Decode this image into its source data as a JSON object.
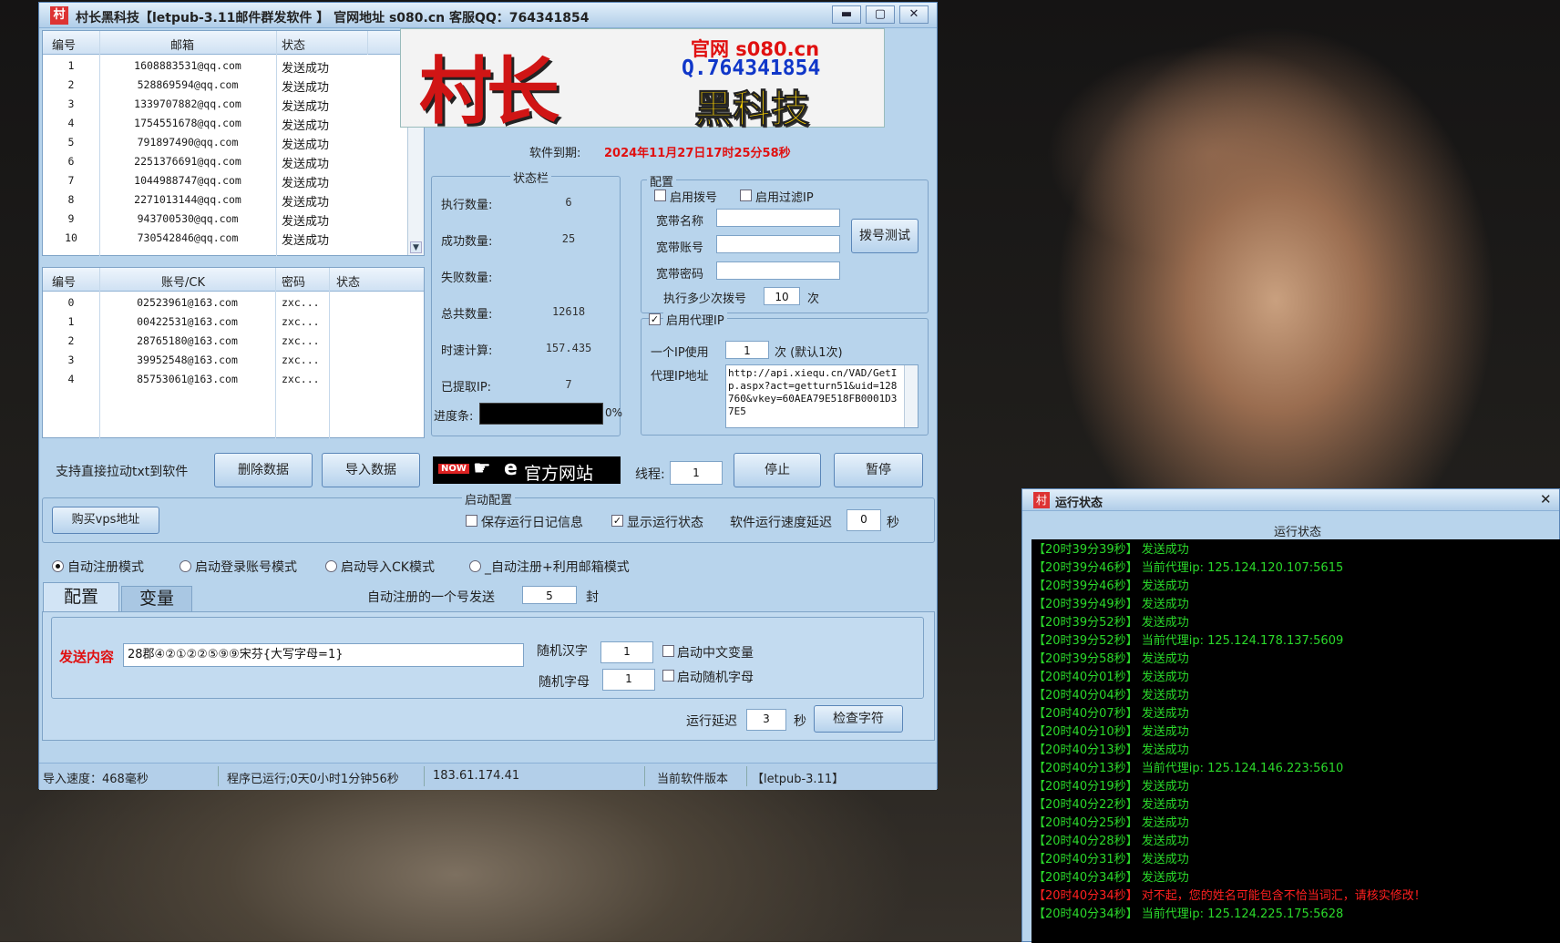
{
  "main_window": {
    "title": "村长黑科技【letpub-3.11邮件群发软件 】   官网地址 s080.cn  客服QQ：764341854",
    "app_icon_char": "村",
    "controls": {
      "minimize": "▬",
      "maximize": "▢",
      "close": "✕"
    }
  },
  "email_list": {
    "headers": [
      "编号",
      "邮箱",
      "状态"
    ],
    "rows": [
      {
        "no": "1",
        "email": "1608883531@qq.com",
        "status": "发送成功"
      },
      {
        "no": "2",
        "email": "528869594@qq.com",
        "status": "发送成功"
      },
      {
        "no": "3",
        "email": "1339707882@qq.com",
        "status": "发送成功"
      },
      {
        "no": "4",
        "email": "1754551678@qq.com",
        "status": "发送成功"
      },
      {
        "no": "5",
        "email": "791897490@qq.com",
        "status": "发送成功"
      },
      {
        "no": "6",
        "email": "2251376691@qq.com",
        "status": "发送成功"
      },
      {
        "no": "7",
        "email": "1044988747@qq.com",
        "status": "发送成功"
      },
      {
        "no": "8",
        "email": "2271013144@qq.com",
        "status": "发送成功"
      },
      {
        "no": "9",
        "email": "943700530@qq.com",
        "status": "发送成功"
      },
      {
        "no": "10",
        "email": "730542846@qq.com",
        "status": "发送成功"
      }
    ]
  },
  "account_list": {
    "headers": [
      "编号",
      "账号/CK",
      "密码",
      "状态"
    ],
    "rows": [
      {
        "no": "0",
        "account": "02523961@163.com",
        "pwd": "zxc..."
      },
      {
        "no": "1",
        "account": "00422531@163.com",
        "pwd": "zxc..."
      },
      {
        "no": "2",
        "account": "28765180@163.com",
        "pwd": "zxc..."
      },
      {
        "no": "3",
        "account": "39952548@163.com",
        "pwd": "zxc..."
      },
      {
        "no": "4",
        "account": "85753061@163.com",
        "pwd": "zxc..."
      }
    ]
  },
  "banner": {
    "logo_text": "村长",
    "line1": "官网 s080.cn",
    "line2": "Q.764341854",
    "line3": "黑科技"
  },
  "expiry": {
    "label": "软件到期:",
    "value": "2024年11月27日17时25分58秒"
  },
  "status_group": {
    "title": "状态栏",
    "items": [
      {
        "label": "执行数量:",
        "value": "6"
      },
      {
        "label": "成功数量:",
        "value": "25"
      },
      {
        "label": "失败数量:",
        "value": ""
      },
      {
        "label": "总共数量:",
        "value": "12618"
      },
      {
        "label": "时速计算:",
        "value": "157.435"
      },
      {
        "label": "已提取IP:",
        "value": "7"
      }
    ],
    "progress_label": "进度条:",
    "progress_text": "0%"
  },
  "config_group": {
    "title": "配置",
    "enable_dial": "启用拨号",
    "enable_filter_ip": "启用过滤IP",
    "bb_name": "宽带名称",
    "bb_account": "宽带账号",
    "bb_password": "宽带密码",
    "dial_test": "拨号测试",
    "dial_every_prefix": "执行多少次拨号",
    "dial_every_value": "10",
    "dial_every_suffix": "次"
  },
  "proxy_group": {
    "enable_proxy": "启用代理IP",
    "per_ip_prefix": "一个IP使用",
    "per_ip_value": "1",
    "per_ip_suffix": "次 (默认1次)",
    "address_label": "代理IP地址",
    "address_value": "http://api.xiequ.cn/VAD/GetIp.aspx?act=getturn51&uid=128760&vkey=60AEA79E518FB0001D37E5"
  },
  "actions": {
    "drag_hint": "支持直接拉动txt到软件",
    "delete": "删除数据",
    "import": "导入数据",
    "now_badge": "NOW",
    "official": "官方网站",
    "threads_label": "线程:",
    "threads_value": "1",
    "stop": "停止",
    "pause": "暂停"
  },
  "startup": {
    "title": "启动配置",
    "buy_vps": "购买vps地址",
    "save_log": "保存运行日记信息",
    "show_status": "显示运行状态",
    "delay_label": "软件运行速度延迟",
    "delay_value": "0",
    "delay_unit": "秒"
  },
  "modes": [
    {
      "label": "自动注册模式",
      "selected": true
    },
    {
      "label": "启动登录账号模式",
      "selected": false
    },
    {
      "label": "启动导入CK模式",
      "selected": false
    },
    {
      "label": "_自动注册+利用邮箱模式",
      "selected": false
    }
  ],
  "tabs": {
    "config": "配置",
    "vars": "变量"
  },
  "auto_reg": {
    "label": "自动注册的一个号发送",
    "value": "5",
    "unit": "封"
  },
  "content": {
    "label": "发送内容",
    "value": "28郡④②①②②⑤⑨⑨宋芬{大写字母=1}",
    "rand_cn_label": "随机汉字",
    "rand_cn_value": "1",
    "enable_cn": "启动中文变量",
    "rand_letter_label": "随机字母",
    "rand_letter_value": "1",
    "enable_letter": "启动随机字母",
    "run_delay_label": "运行延迟",
    "run_delay_value": "3",
    "run_delay_unit": "秒",
    "check": "检查字符"
  },
  "statusbar": {
    "import_speed": "导入速度：468毫秒",
    "running": "程序已运行;0天0小时1分钟56秒",
    "ip": "183.61.174.41",
    "version_label": "当前软件版本",
    "version": "【letpub-3.11】"
  },
  "run_window": {
    "title": "运行状态",
    "group_title": "运行状态",
    "close": "✕",
    "log": [
      {
        "text": "【20时39分39秒】 发送成功",
        "type": "ok"
      },
      {
        "text": "【20时39分46秒】 当前代理ip: 125.124.120.107:5615",
        "type": "ok"
      },
      {
        "text": "【20时39分46秒】 发送成功",
        "type": "ok"
      },
      {
        "text": "【20时39分49秒】 发送成功",
        "type": "ok"
      },
      {
        "text": "【20时39分52秒】 发送成功",
        "type": "ok"
      },
      {
        "text": "【20时39分52秒】 当前代理ip: 125.124.178.137:5609",
        "type": "ok"
      },
      {
        "text": "【20时39分58秒】 发送成功",
        "type": "ok"
      },
      {
        "text": "【20时40分01秒】 发送成功",
        "type": "ok"
      },
      {
        "text": "【20时40分04秒】 发送成功",
        "type": "ok"
      },
      {
        "text": "【20时40分07秒】 发送成功",
        "type": "ok"
      },
      {
        "text": "【20时40分10秒】 发送成功",
        "type": "ok"
      },
      {
        "text": "【20时40分13秒】 发送成功",
        "type": "ok"
      },
      {
        "text": "【20时40分13秒】 当前代理ip: 125.124.146.223:5610",
        "type": "ok"
      },
      {
        "text": "【20时40分19秒】 发送成功",
        "type": "ok"
      },
      {
        "text": "【20时40分22秒】 发送成功",
        "type": "ok"
      },
      {
        "text": "【20时40分25秒】 发送成功",
        "type": "ok"
      },
      {
        "text": "【20时40分28秒】 发送成功",
        "type": "ok"
      },
      {
        "text": "【20时40分31秒】 发送成功",
        "type": "ok"
      },
      {
        "text": "【20时40分34秒】 发送成功",
        "type": "ok"
      },
      {
        "text": "【20时40分34秒】 对不起，您的姓名可能包含不恰当词汇，请核实修改！",
        "type": "err"
      },
      {
        "text": "【20时40分34秒】 当前代理ip: 125.124.225.175:5628",
        "type": "ok"
      }
    ]
  },
  "colors": {
    "window_bg": "#b8d4ec",
    "accent_red": "#e01010",
    "log_green": "#2bd92b",
    "log_red": "#ff2020"
  }
}
